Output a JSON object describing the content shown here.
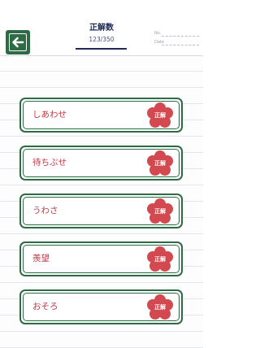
{
  "header": {
    "title": "正解数",
    "count": "123/350",
    "no_label": "No.",
    "date_label": "Date"
  },
  "items": [
    {
      "word": "しあわせ",
      "badge": "正解"
    },
    {
      "word": "待ちぶせ",
      "badge": "正解"
    },
    {
      "word": "うわさ",
      "badge": "正解"
    },
    {
      "word": "羨望",
      "badge": "正解"
    },
    {
      "word": "おそろ",
      "badge": "正解"
    }
  ],
  "colors": {
    "accent_green": "#2e6a44",
    "word_red": "#c23847",
    "badge_red": "#d2494f",
    "title_navy": "#1f2a55"
  },
  "icons": {
    "back": "arrow-left-icon",
    "badge": "flower-badge-icon"
  }
}
